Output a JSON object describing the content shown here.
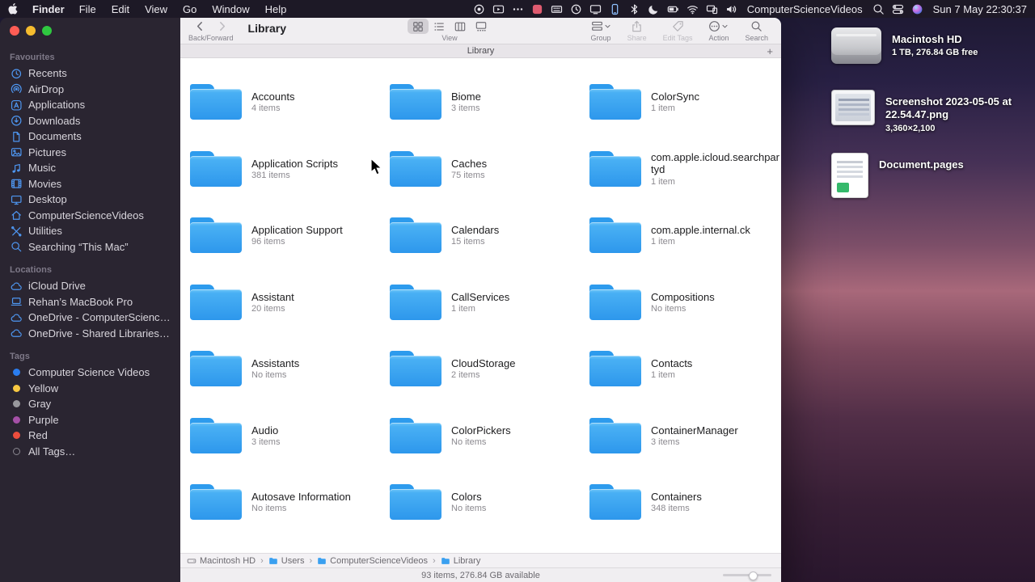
{
  "menubar": {
    "app_name": "Finder",
    "menus": [
      "File",
      "Edit",
      "View",
      "Go",
      "Window",
      "Help"
    ],
    "status_icons": [
      "record-icon",
      "screen-mirroring-icon",
      "more-icon",
      "pink-app-icon",
      "keyboard-icon",
      "time-machine-icon",
      "display-icon",
      "phone-icon",
      "bluetooth-icon",
      "moon-icon",
      "battery-icon",
      "wifi-icon",
      "sidecar-icon",
      "volume-icon"
    ],
    "right_icons": [
      "spotlight-icon",
      "control-center-icon",
      "siri-icon"
    ],
    "user_name": "ComputerScienceVideos",
    "clock": "Sun 7 May 22:30:37"
  },
  "window": {
    "toolbar": {
      "title": "Library",
      "back_forward_label": "Back/Forward",
      "view_label": "View",
      "group_label": "Group",
      "share_label": "Share",
      "edit_tags_label": "Edit Tags",
      "action_label": "Action",
      "search_label": "Search"
    },
    "tab_bar": {
      "tab_title": "Library",
      "new_tab_label": "+"
    },
    "sidebar": {
      "sections": [
        {
          "title": "Favourites",
          "items": [
            {
              "label": "Recents",
              "icon": "clock"
            },
            {
              "label": "AirDrop",
              "icon": "airdrop"
            },
            {
              "label": "Applications",
              "icon": "applications"
            },
            {
              "label": "Downloads",
              "icon": "downloads"
            },
            {
              "label": "Documents",
              "icon": "document"
            },
            {
              "label": "Pictures",
              "icon": "photo"
            },
            {
              "label": "Music",
              "icon": "music"
            },
            {
              "label": "Movies",
              "icon": "film"
            },
            {
              "label": "Desktop",
              "icon": "desktop"
            },
            {
              "label": "ComputerScienceVideos",
              "icon": "home"
            },
            {
              "label": "Utilities",
              "icon": "utilities"
            },
            {
              "label": "Searching “This Mac”",
              "icon": "search"
            }
          ]
        },
        {
          "title": "Locations",
          "items": [
            {
              "label": "iCloud Drive",
              "icon": "cloud"
            },
            {
              "label": "Rehan’s MacBook Pro",
              "icon": "laptop"
            },
            {
              "label": "OneDrive - ComputerScienceVideos",
              "icon": "cloud"
            },
            {
              "label": "OneDrive - Shared Libraries - Comp…",
              "icon": "cloud"
            }
          ]
        },
        {
          "title": "Tags",
          "items": [
            {
              "label": "Computer Science Videos",
              "color": "#2a7df0"
            },
            {
              "label": "Yellow",
              "color": "#f8c842"
            },
            {
              "label": "Gray",
              "color": "#98989d"
            },
            {
              "label": "Purple",
              "color": "#a550a7"
            },
            {
              "label": "Red",
              "color": "#ec4d3d"
            },
            {
              "label": "All Tags…",
              "color": ""
            }
          ]
        }
      ]
    },
    "content": {
      "folders": [
        {
          "name": "Accounts",
          "count": "4 items"
        },
        {
          "name": "Biome",
          "count": "3 items"
        },
        {
          "name": "ColorSync",
          "count": "1 item"
        },
        {
          "name": "Application Scripts",
          "count": "381 items"
        },
        {
          "name": "Caches",
          "count": "75 items"
        },
        {
          "name": "com.apple.icloud.searchpartyd",
          "count": "1 item"
        },
        {
          "name": "Application Support",
          "count": "96 items"
        },
        {
          "name": "Calendars",
          "count": "15 items"
        },
        {
          "name": "com.apple.internal.ck",
          "count": "1 item"
        },
        {
          "name": "Assistant",
          "count": "20 items"
        },
        {
          "name": "CallServices",
          "count": "1 item"
        },
        {
          "name": "Compositions",
          "count": "No items"
        },
        {
          "name": "Assistants",
          "count": "No items"
        },
        {
          "name": "CloudStorage",
          "count": "2 items"
        },
        {
          "name": "Contacts",
          "count": "1 item"
        },
        {
          "name": "Audio",
          "count": "3 items"
        },
        {
          "name": "ColorPickers",
          "count": "No items"
        },
        {
          "name": "ContainerManager",
          "count": "3 items"
        },
        {
          "name": "Autosave Information",
          "count": "No items"
        },
        {
          "name": "Colors",
          "count": "No items"
        },
        {
          "name": "Containers",
          "count": "348 items"
        }
      ]
    },
    "path_bar": {
      "segments": [
        {
          "label": "Macintosh HD",
          "icon": "drive"
        },
        {
          "label": "Users",
          "icon": "folder"
        },
        {
          "label": "ComputerScienceVideos",
          "icon": "folder"
        },
        {
          "label": "Library",
          "icon": "folder"
        }
      ]
    },
    "status_bar": {
      "text": "93 items, 276.84 GB available"
    }
  },
  "desktop": {
    "icons": [
      {
        "label": "Macintosh HD",
        "info": "1 TB, 276.84 GB free",
        "type": "drive"
      },
      {
        "label": "Screenshot 2023-05-05 at 22.54.47.png",
        "info": "3,360×2,100",
        "type": "image"
      },
      {
        "label": "Document.pages",
        "info": "",
        "type": "pages"
      }
    ]
  },
  "colors": {
    "folder_blue": "#2d97ec",
    "sidebar_bg": "#2a2531",
    "accent_blue": "#4e97f2"
  }
}
